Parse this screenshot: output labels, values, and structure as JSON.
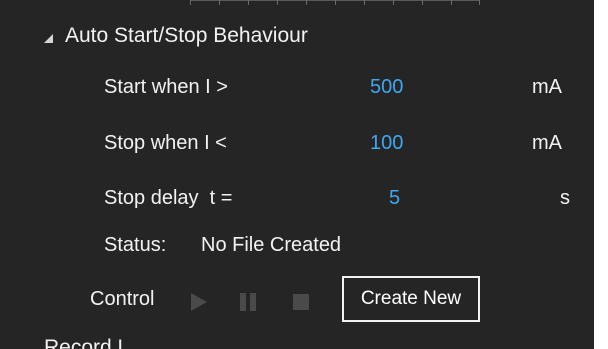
{
  "section": {
    "title": "Auto Start/Stop Behaviour",
    "expanded": true
  },
  "settings": [
    {
      "label": "Start when I >",
      "value": "500",
      "unit": "mA"
    },
    {
      "label": "Stop when I <",
      "value": "100",
      "unit": "mA"
    },
    {
      "label": "Stop delay  t =",
      "value": "5",
      "unit": "s"
    }
  ],
  "status": {
    "label": "Status:",
    "text": "No File Created"
  },
  "control": {
    "label": "Control",
    "play_icon": "play-icon",
    "pause_icon": "pause-icon",
    "stop_icon": "stop-icon",
    "create_button": "Create New"
  },
  "next_section": {
    "title": "Record L"
  },
  "colors": {
    "panel_background": "#252526",
    "text": "#f2f2f2",
    "value_accent": "#3ea7f0",
    "disabled_icon": "#4a4a4a"
  }
}
